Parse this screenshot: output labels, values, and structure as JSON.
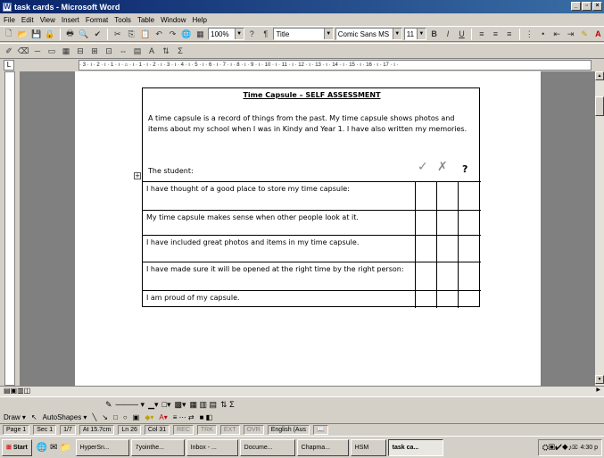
{
  "window": {
    "title": "task cards - Microsoft Word"
  },
  "menu": [
    "File",
    "Edit",
    "View",
    "Insert",
    "Format",
    "Tools",
    "Table",
    "Window",
    "Help"
  ],
  "toolbar": {
    "zoom": "100%",
    "style": "Title",
    "font": "Comic Sans MS",
    "size": "11",
    "bold": "B",
    "italic": "I",
    "underline": "U"
  },
  "ruler": "· 3 · ı · 2 · ı · 1 · ı · ⌂ · ı · 1 · ı · 2 · ı · 3 · ı · 4 · ı · 5 · ı · 6 · ı · 7 · ı · 8 · ı · 9 · ı · 10 · ı · 11 · ı · 12 · ı · 13 · ı · 14 · ı · 15 · ı · 16 · ı · 17 · ı ·",
  "document": {
    "title": "Time Capsule – SELF ASSESSMENT",
    "intro": "A time capsule is a record of things from the past. My time capsule shows photos and items about my school when I was in Kindy and Year 1.  I have also written my memories.",
    "student_label": "The student:",
    "col_marks": [
      "✓",
      "✗",
      "?"
    ],
    "rows": [
      "I have thought of a good place to store my time capsule:",
      "My time capsule makes sense when other people look at it.",
      "I have included great photos and items in my time capsule.",
      "I have made sure it will be opened at the right time by the right person:",
      "I am proud of my capsule."
    ]
  },
  "drawing": {
    "draw": "Draw ▾",
    "autoshapes": "AutoShapes ▾"
  },
  "status": {
    "page": "Page 1",
    "sec": "Sec 1",
    "pages": "1/7",
    "at": "At 15.7cm",
    "ln": "Ln 26",
    "col": "Col 31",
    "rec": "REC",
    "trk": "TRK",
    "ext": "EXT",
    "ovr": "OVR",
    "lang": "English (Aus"
  },
  "taskbar": {
    "start": "Start",
    "buttons": [
      "HyperSn...",
      "7yointhe...",
      "Inbox - ...",
      "Docume...",
      "Chapma...",
      "HSM",
      "task ca..."
    ],
    "clock": "4:30 p"
  }
}
